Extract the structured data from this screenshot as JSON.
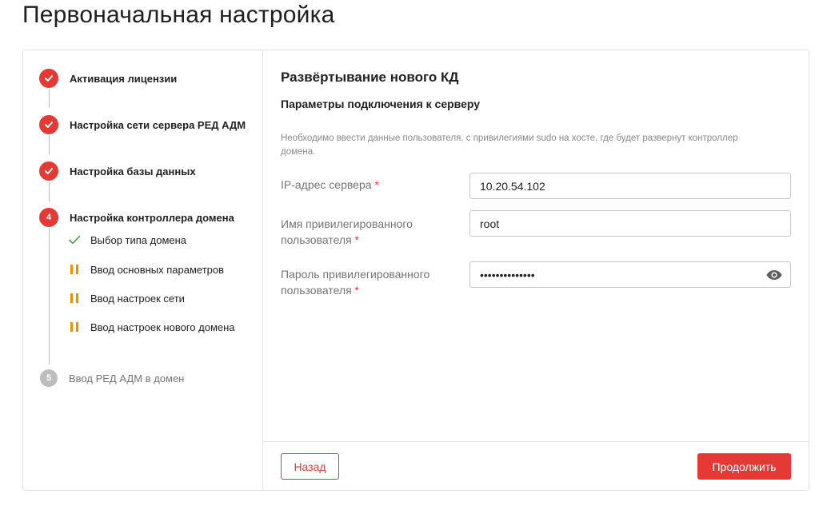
{
  "page": {
    "title": "Первоначальная настройка"
  },
  "stepper": {
    "steps": [
      {
        "label": "Активация лицензии",
        "status": "done"
      },
      {
        "label": "Настройка сети сервера РЕД АДМ",
        "status": "done"
      },
      {
        "label": "Настройка базы данных",
        "status": "done"
      },
      {
        "label": "Настройка контроллера домена",
        "status": "active",
        "number": "4"
      },
      {
        "label": "Ввод РЕД АДМ в домен",
        "status": "pending",
        "number": "5"
      }
    ],
    "substeps": [
      {
        "label": "Выбор типа домена",
        "status": "done"
      },
      {
        "label": "Ввод основных параметров",
        "status": "pending"
      },
      {
        "label": "Ввод настроек сети",
        "status": "pending"
      },
      {
        "label": "Ввод настроек нового домена",
        "status": "pending"
      }
    ]
  },
  "content": {
    "section_title": "Развёртывание нового КД",
    "subsection_title": "Параметры подключения к серверу",
    "hint": "Необходимо ввести данные пользователя, с привилегиями sudo на хосте, где будет развернут контроллер домена.",
    "fields": {
      "ip": {
        "label": "IP-адрес сервера",
        "required_mark": "*",
        "value": "10.20.54.102"
      },
      "user": {
        "label_line1": "Имя привилегированного",
        "label_line2": "пользователя",
        "required_mark": "*",
        "value": "root"
      },
      "password": {
        "label_line1": "Пароль привилегированного",
        "label_line2": "пользователя",
        "required_mark": "*",
        "value": "••••••••••••••",
        "icon": "eye-icon"
      }
    }
  },
  "footer": {
    "back_label": "Назад",
    "next_label": "Продолжить"
  },
  "colors": {
    "accent": "#e53935",
    "pending_step": "#bdbdbd",
    "substep_pause": "#ef8f00",
    "substep_done": "#43a047"
  }
}
